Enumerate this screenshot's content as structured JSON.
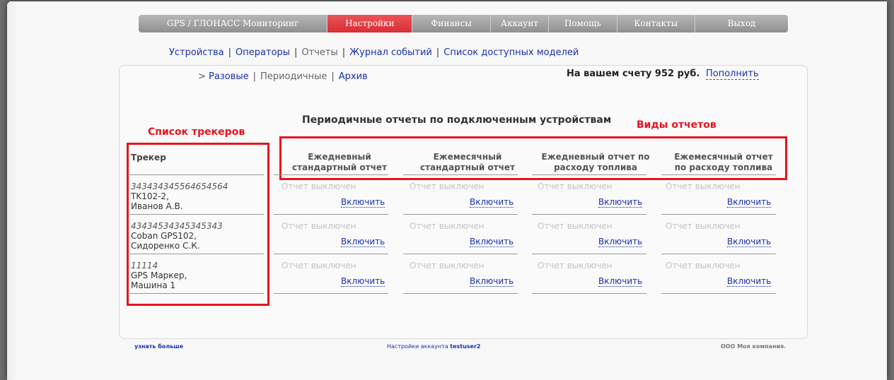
{
  "nav": [
    "GPS / ГЛОНАСС Мониторинг",
    "Настройки",
    "Финансы",
    "Аккаунт",
    "Помощь",
    "Контакты",
    "Выход"
  ],
  "subnav": [
    "Устройства",
    "Операторы",
    "Отчеты",
    "Журнал событий",
    "Список доступных моделей"
  ],
  "tabs": {
    "arrow": ">",
    "one_time": "Разовые",
    "periodic": "Периодичные",
    "archive": "Архив"
  },
  "balance": {
    "text": "На вашем счету 952 руб.",
    "topup": "Пополнить"
  },
  "heading": "Периодичные отчеты по подключенным устройствам",
  "annotations": {
    "trackers": "Список трекеров",
    "report_types": "Виды отчетов"
  },
  "trackers": {
    "header": "Трекер",
    "items": [
      {
        "id": "343434345564654564",
        "model": "TK102-2,",
        "name": "Иванов А.В."
      },
      {
        "id": "43434534345345343",
        "model": "Coban GPS102,",
        "name": "Сидоренко С.К."
      },
      {
        "id": "11114",
        "model": "GPS Маркер,",
        "name": "Машина 1"
      }
    ]
  },
  "columns": [
    {
      "l1": "Ежедневный",
      "l2": "стандартный отчет"
    },
    {
      "l1": "Ежемесячный",
      "l2": "стандартный отчет"
    },
    {
      "l1": "Ежедневный отчет по",
      "l2": "расходу топлива"
    },
    {
      "l1": "Ежемесячный отчет",
      "l2": "по расходу топлива"
    }
  ],
  "cell": {
    "status": "Отчет выключен",
    "action": "Включить"
  },
  "footer": {
    "learn_more": "узнать больше",
    "account_prefix": "Настройки аккаунта",
    "username": "testuser2",
    "company": "ООО Моя компания."
  },
  "colors": {
    "active_tab": "#d92e34",
    "link": "#1a2fb0",
    "annotation": "#e8141e"
  }
}
